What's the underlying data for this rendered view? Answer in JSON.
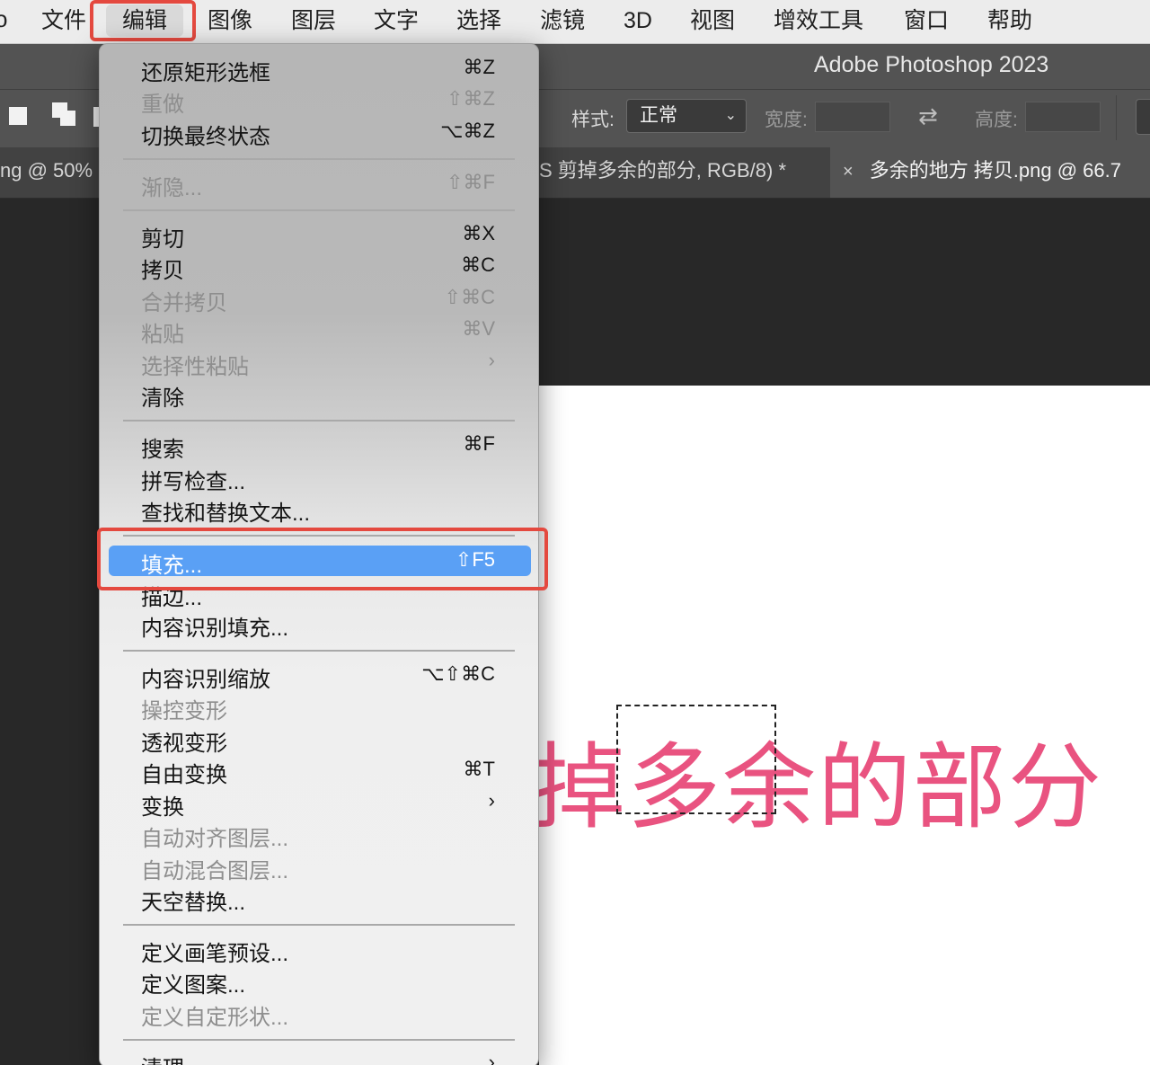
{
  "menubar": {
    "apple_fragment": "o",
    "items": [
      "文件",
      "编辑",
      "图像",
      "图层",
      "文字",
      "选择",
      "滤镜",
      "3D",
      "视图",
      "增效工具",
      "窗口",
      "帮助"
    ]
  },
  "titlebar": {
    "title": "Adobe Photoshop 2023"
  },
  "options": {
    "style_label": "样式:",
    "style_value": "正常",
    "width_label": "宽度:",
    "height_label": "高度:"
  },
  "tabs": {
    "left": "ng @ 50%",
    "middle": "S 剪掉多余的部分, RGB/8) *",
    "right_close": "×",
    "right": "多余的地方 拷贝.png @ 66.7"
  },
  "canvas": {
    "text": "掉多余的部分"
  },
  "menu": {
    "items": [
      {
        "label": "还原矩形选框",
        "shortcut": "⌘Z",
        "disabled": false
      },
      {
        "label": "重做",
        "shortcut": "⇧⌘Z",
        "disabled": true
      },
      {
        "label": "切换最终状态",
        "shortcut": "⌥⌘Z",
        "disabled": false
      },
      {
        "label": "渐隐...",
        "shortcut": "⇧⌘F",
        "disabled": true
      },
      {
        "label": "剪切",
        "shortcut": "⌘X",
        "disabled": false
      },
      {
        "label": "拷贝",
        "shortcut": "⌘C",
        "disabled": false
      },
      {
        "label": "合并拷贝",
        "shortcut": "⇧⌘C",
        "disabled": true
      },
      {
        "label": "粘贴",
        "shortcut": "⌘V",
        "disabled": true
      },
      {
        "label": "选择性粘贴",
        "shortcut": "›",
        "disabled": true
      },
      {
        "label": "清除",
        "shortcut": "",
        "disabled": false
      },
      {
        "label": "搜索",
        "shortcut": "⌘F",
        "disabled": false
      },
      {
        "label": "拼写检查...",
        "shortcut": "",
        "disabled": false
      },
      {
        "label": "查找和替换文本...",
        "shortcut": "",
        "disabled": false
      },
      {
        "label": "填充...",
        "shortcut": "⇧F5",
        "disabled": false,
        "selected": true
      },
      {
        "label": "描边...",
        "shortcut": "",
        "disabled": false
      },
      {
        "label": "内容识别填充...",
        "shortcut": "",
        "disabled": false
      },
      {
        "label": "内容识别缩放",
        "shortcut": "⌥⇧⌘C",
        "disabled": false
      },
      {
        "label": "操控变形",
        "shortcut": "",
        "disabled": true
      },
      {
        "label": "透视变形",
        "shortcut": "",
        "disabled": false
      },
      {
        "label": "自由变换",
        "shortcut": "⌘T",
        "disabled": false
      },
      {
        "label": "变换",
        "shortcut": "›",
        "disabled": false
      },
      {
        "label": "自动对齐图层...",
        "shortcut": "",
        "disabled": true
      },
      {
        "label": "自动混合图层...",
        "shortcut": "",
        "disabled": true
      },
      {
        "label": "天空替换...",
        "shortcut": "",
        "disabled": false
      },
      {
        "label": "定义画笔预设...",
        "shortcut": "",
        "disabled": false
      },
      {
        "label": "定义图案...",
        "shortcut": "",
        "disabled": false
      },
      {
        "label": "定义自定形状...",
        "shortcut": "",
        "disabled": true
      },
      {
        "label": "清理",
        "shortcut": "›",
        "disabled": false
      }
    ]
  },
  "colors": {
    "highlight_box": "#e4493f",
    "selected_item": "#5aa0f5",
    "canvas_text": "#e95380"
  }
}
